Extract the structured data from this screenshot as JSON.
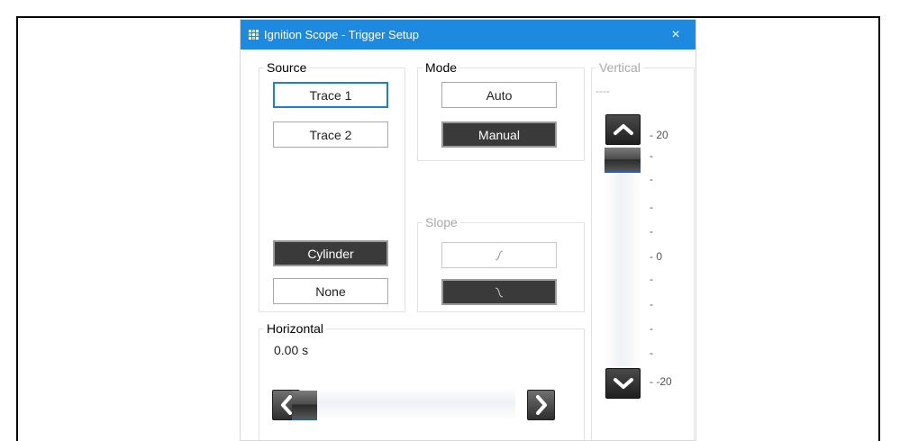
{
  "window": {
    "title": "Ignition Scope - Trigger Setup",
    "close_glyph": "×"
  },
  "source": {
    "title": "Source",
    "trace1": "Trace 1",
    "trace2": "Trace 2",
    "cylinder": "Cylinder",
    "none": "None"
  },
  "mode": {
    "title": "Mode",
    "auto": "Auto",
    "manual": "Manual"
  },
  "slope": {
    "title": "Slope",
    "rising_icon": "rising-edge-icon",
    "falling_icon": "falling-edge-icon"
  },
  "horizontal": {
    "title": "Horizontal",
    "value": "0.00 s"
  },
  "vertical": {
    "title": "Vertical",
    "value": "----",
    "ticks": [
      "- 20",
      "-",
      "-",
      "-",
      "-",
      "- 0",
      "-",
      "-",
      "-",
      "-",
      "- -20"
    ]
  },
  "colors": {
    "titlebar": "#1d8ae0",
    "selected": "#3a3a3a",
    "focus": "#1a7fd6"
  }
}
